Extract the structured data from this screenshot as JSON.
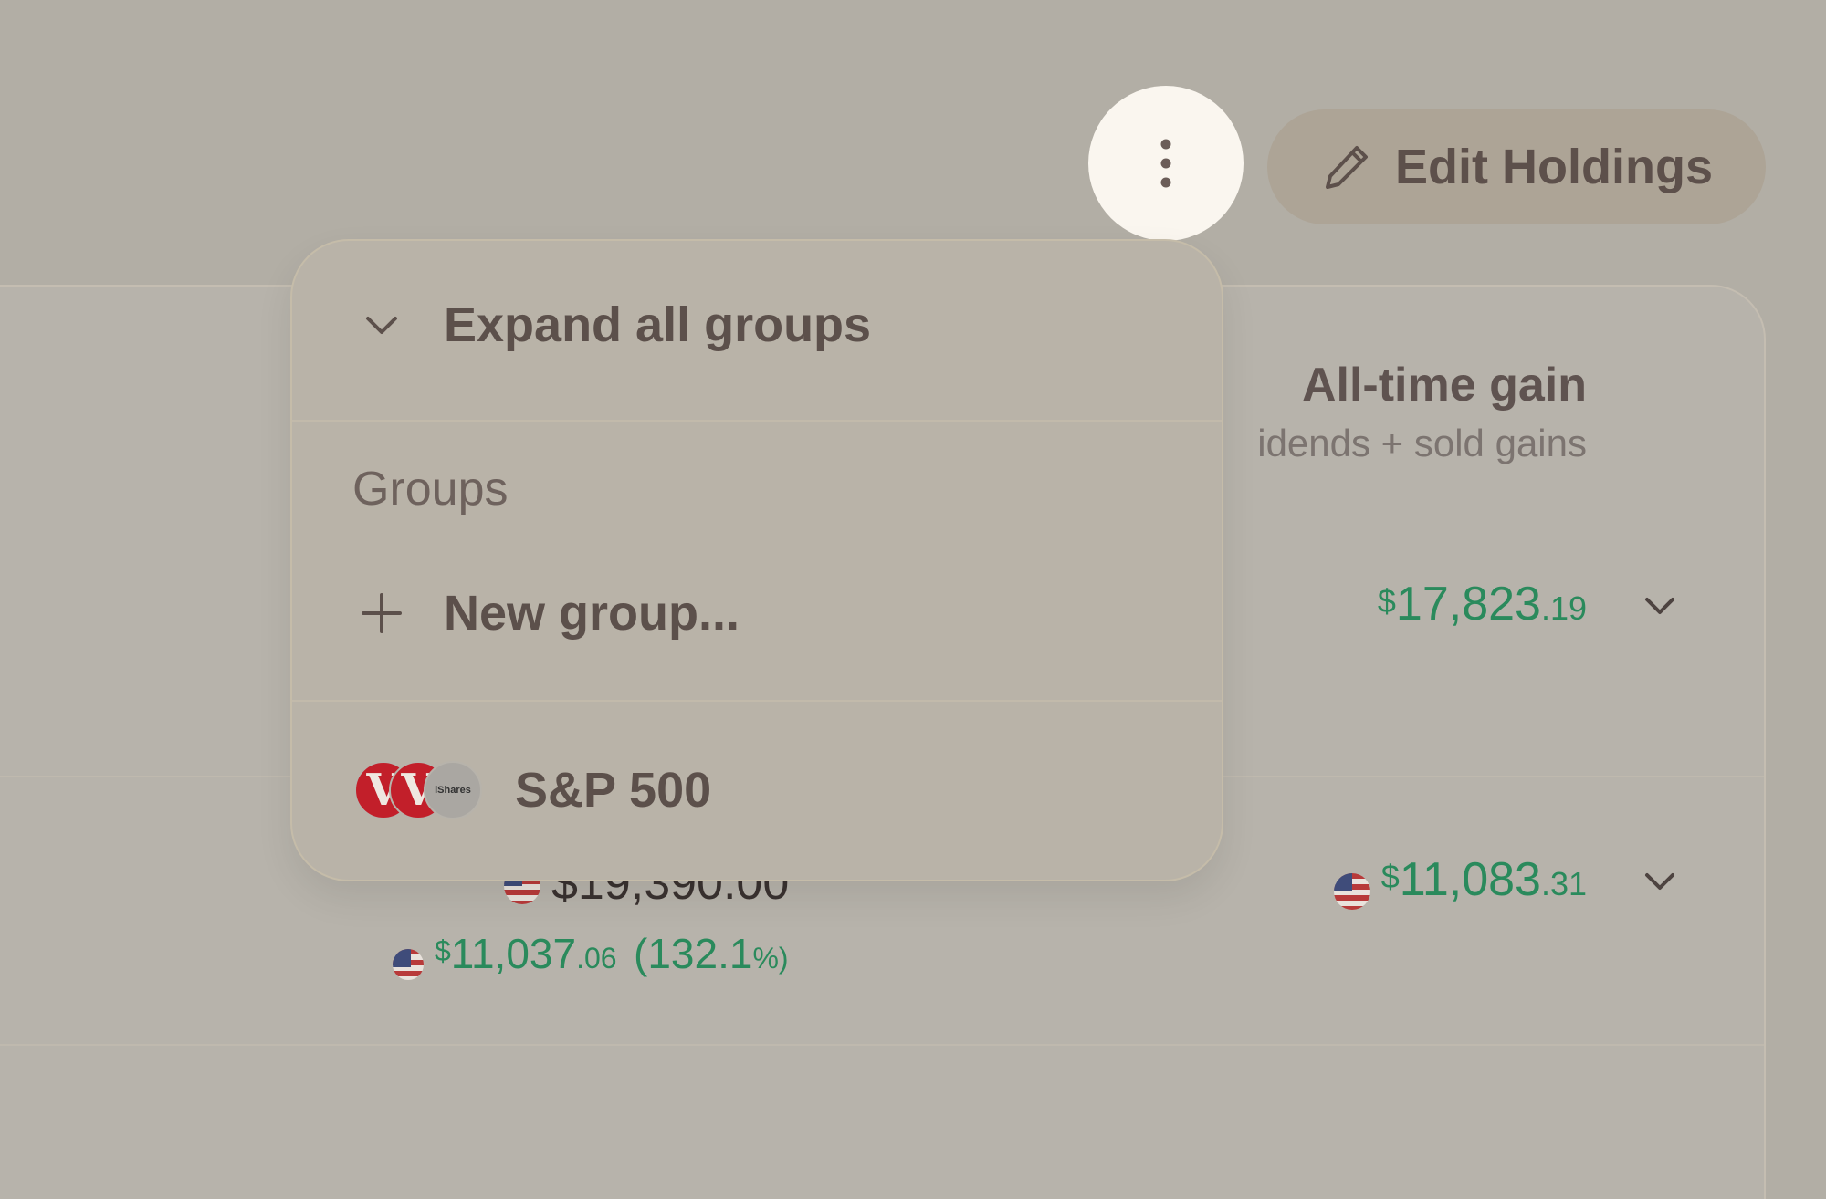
{
  "header": {
    "more_icon": "vertical-dots-icon",
    "edit_holdings_label": "Edit Holdings",
    "edit_icon": "pencil-icon"
  },
  "table": {
    "column_title": "All-time gain",
    "column_subtitle": "idends + sold gains",
    "rows": [
      {
        "gain_dollar": "17,823",
        "gain_cents": ".19",
        "currency_symbol": "$"
      },
      {
        "gain_dollar": "11,083",
        "gain_cents": ".31",
        "currency_symbol": "$",
        "value_partial": "$19,390.00",
        "sub_gain_dollar": "11,037",
        "sub_gain_cents": ".06",
        "sub_gain_pct_main": "(132.1",
        "sub_gain_pct_suffix": "%)"
      }
    ]
  },
  "menu": {
    "expand_label": "Expand all groups",
    "groups_heading": "Groups",
    "new_group_label": "New group...",
    "group_items": [
      {
        "label": "S&P 500",
        "logos": [
          "V",
          "V",
          "iShares"
        ]
      }
    ]
  },
  "colors": {
    "gain_green": "#2a8a5c",
    "text_dark": "#5c504b",
    "highlight_circle": "#faf6ef"
  }
}
